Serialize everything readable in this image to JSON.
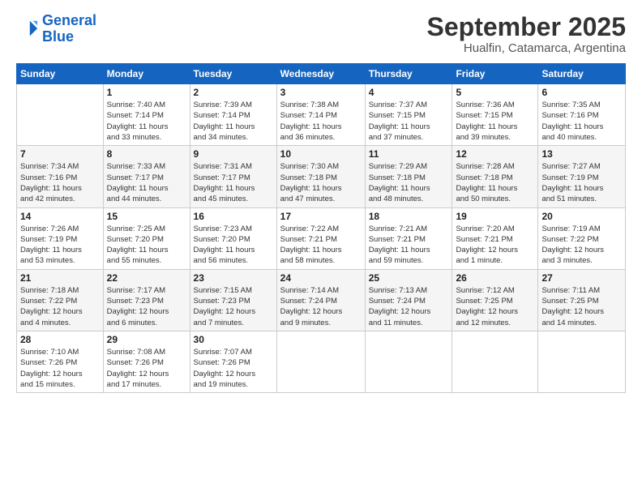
{
  "header": {
    "logo_line1": "General",
    "logo_line2": "Blue",
    "month": "September 2025",
    "location": "Hualfin, Catamarca, Argentina"
  },
  "weekdays": [
    "Sunday",
    "Monday",
    "Tuesday",
    "Wednesday",
    "Thursday",
    "Friday",
    "Saturday"
  ],
  "weeks": [
    [
      {
        "day": "",
        "info": ""
      },
      {
        "day": "1",
        "info": "Sunrise: 7:40 AM\nSunset: 7:14 PM\nDaylight: 11 hours\nand 33 minutes."
      },
      {
        "day": "2",
        "info": "Sunrise: 7:39 AM\nSunset: 7:14 PM\nDaylight: 11 hours\nand 34 minutes."
      },
      {
        "day": "3",
        "info": "Sunrise: 7:38 AM\nSunset: 7:14 PM\nDaylight: 11 hours\nand 36 minutes."
      },
      {
        "day": "4",
        "info": "Sunrise: 7:37 AM\nSunset: 7:15 PM\nDaylight: 11 hours\nand 37 minutes."
      },
      {
        "day": "5",
        "info": "Sunrise: 7:36 AM\nSunset: 7:15 PM\nDaylight: 11 hours\nand 39 minutes."
      },
      {
        "day": "6",
        "info": "Sunrise: 7:35 AM\nSunset: 7:16 PM\nDaylight: 11 hours\nand 40 minutes."
      }
    ],
    [
      {
        "day": "7",
        "info": "Sunrise: 7:34 AM\nSunset: 7:16 PM\nDaylight: 11 hours\nand 42 minutes."
      },
      {
        "day": "8",
        "info": "Sunrise: 7:33 AM\nSunset: 7:17 PM\nDaylight: 11 hours\nand 44 minutes."
      },
      {
        "day": "9",
        "info": "Sunrise: 7:31 AM\nSunset: 7:17 PM\nDaylight: 11 hours\nand 45 minutes."
      },
      {
        "day": "10",
        "info": "Sunrise: 7:30 AM\nSunset: 7:18 PM\nDaylight: 11 hours\nand 47 minutes."
      },
      {
        "day": "11",
        "info": "Sunrise: 7:29 AM\nSunset: 7:18 PM\nDaylight: 11 hours\nand 48 minutes."
      },
      {
        "day": "12",
        "info": "Sunrise: 7:28 AM\nSunset: 7:18 PM\nDaylight: 11 hours\nand 50 minutes."
      },
      {
        "day": "13",
        "info": "Sunrise: 7:27 AM\nSunset: 7:19 PM\nDaylight: 11 hours\nand 51 minutes."
      }
    ],
    [
      {
        "day": "14",
        "info": "Sunrise: 7:26 AM\nSunset: 7:19 PM\nDaylight: 11 hours\nand 53 minutes."
      },
      {
        "day": "15",
        "info": "Sunrise: 7:25 AM\nSunset: 7:20 PM\nDaylight: 11 hours\nand 55 minutes."
      },
      {
        "day": "16",
        "info": "Sunrise: 7:23 AM\nSunset: 7:20 PM\nDaylight: 11 hours\nand 56 minutes."
      },
      {
        "day": "17",
        "info": "Sunrise: 7:22 AM\nSunset: 7:21 PM\nDaylight: 11 hours\nand 58 minutes."
      },
      {
        "day": "18",
        "info": "Sunrise: 7:21 AM\nSunset: 7:21 PM\nDaylight: 11 hours\nand 59 minutes."
      },
      {
        "day": "19",
        "info": "Sunrise: 7:20 AM\nSunset: 7:21 PM\nDaylight: 12 hours\nand 1 minute."
      },
      {
        "day": "20",
        "info": "Sunrise: 7:19 AM\nSunset: 7:22 PM\nDaylight: 12 hours\nand 3 minutes."
      }
    ],
    [
      {
        "day": "21",
        "info": "Sunrise: 7:18 AM\nSunset: 7:22 PM\nDaylight: 12 hours\nand 4 minutes."
      },
      {
        "day": "22",
        "info": "Sunrise: 7:17 AM\nSunset: 7:23 PM\nDaylight: 12 hours\nand 6 minutes."
      },
      {
        "day": "23",
        "info": "Sunrise: 7:15 AM\nSunset: 7:23 PM\nDaylight: 12 hours\nand 7 minutes."
      },
      {
        "day": "24",
        "info": "Sunrise: 7:14 AM\nSunset: 7:24 PM\nDaylight: 12 hours\nand 9 minutes."
      },
      {
        "day": "25",
        "info": "Sunrise: 7:13 AM\nSunset: 7:24 PM\nDaylight: 12 hours\nand 11 minutes."
      },
      {
        "day": "26",
        "info": "Sunrise: 7:12 AM\nSunset: 7:25 PM\nDaylight: 12 hours\nand 12 minutes."
      },
      {
        "day": "27",
        "info": "Sunrise: 7:11 AM\nSunset: 7:25 PM\nDaylight: 12 hours\nand 14 minutes."
      }
    ],
    [
      {
        "day": "28",
        "info": "Sunrise: 7:10 AM\nSunset: 7:26 PM\nDaylight: 12 hours\nand 15 minutes."
      },
      {
        "day": "29",
        "info": "Sunrise: 7:08 AM\nSunset: 7:26 PM\nDaylight: 12 hours\nand 17 minutes."
      },
      {
        "day": "30",
        "info": "Sunrise: 7:07 AM\nSunset: 7:26 PM\nDaylight: 12 hours\nand 19 minutes."
      },
      {
        "day": "",
        "info": ""
      },
      {
        "day": "",
        "info": ""
      },
      {
        "day": "",
        "info": ""
      },
      {
        "day": "",
        "info": ""
      }
    ]
  ]
}
